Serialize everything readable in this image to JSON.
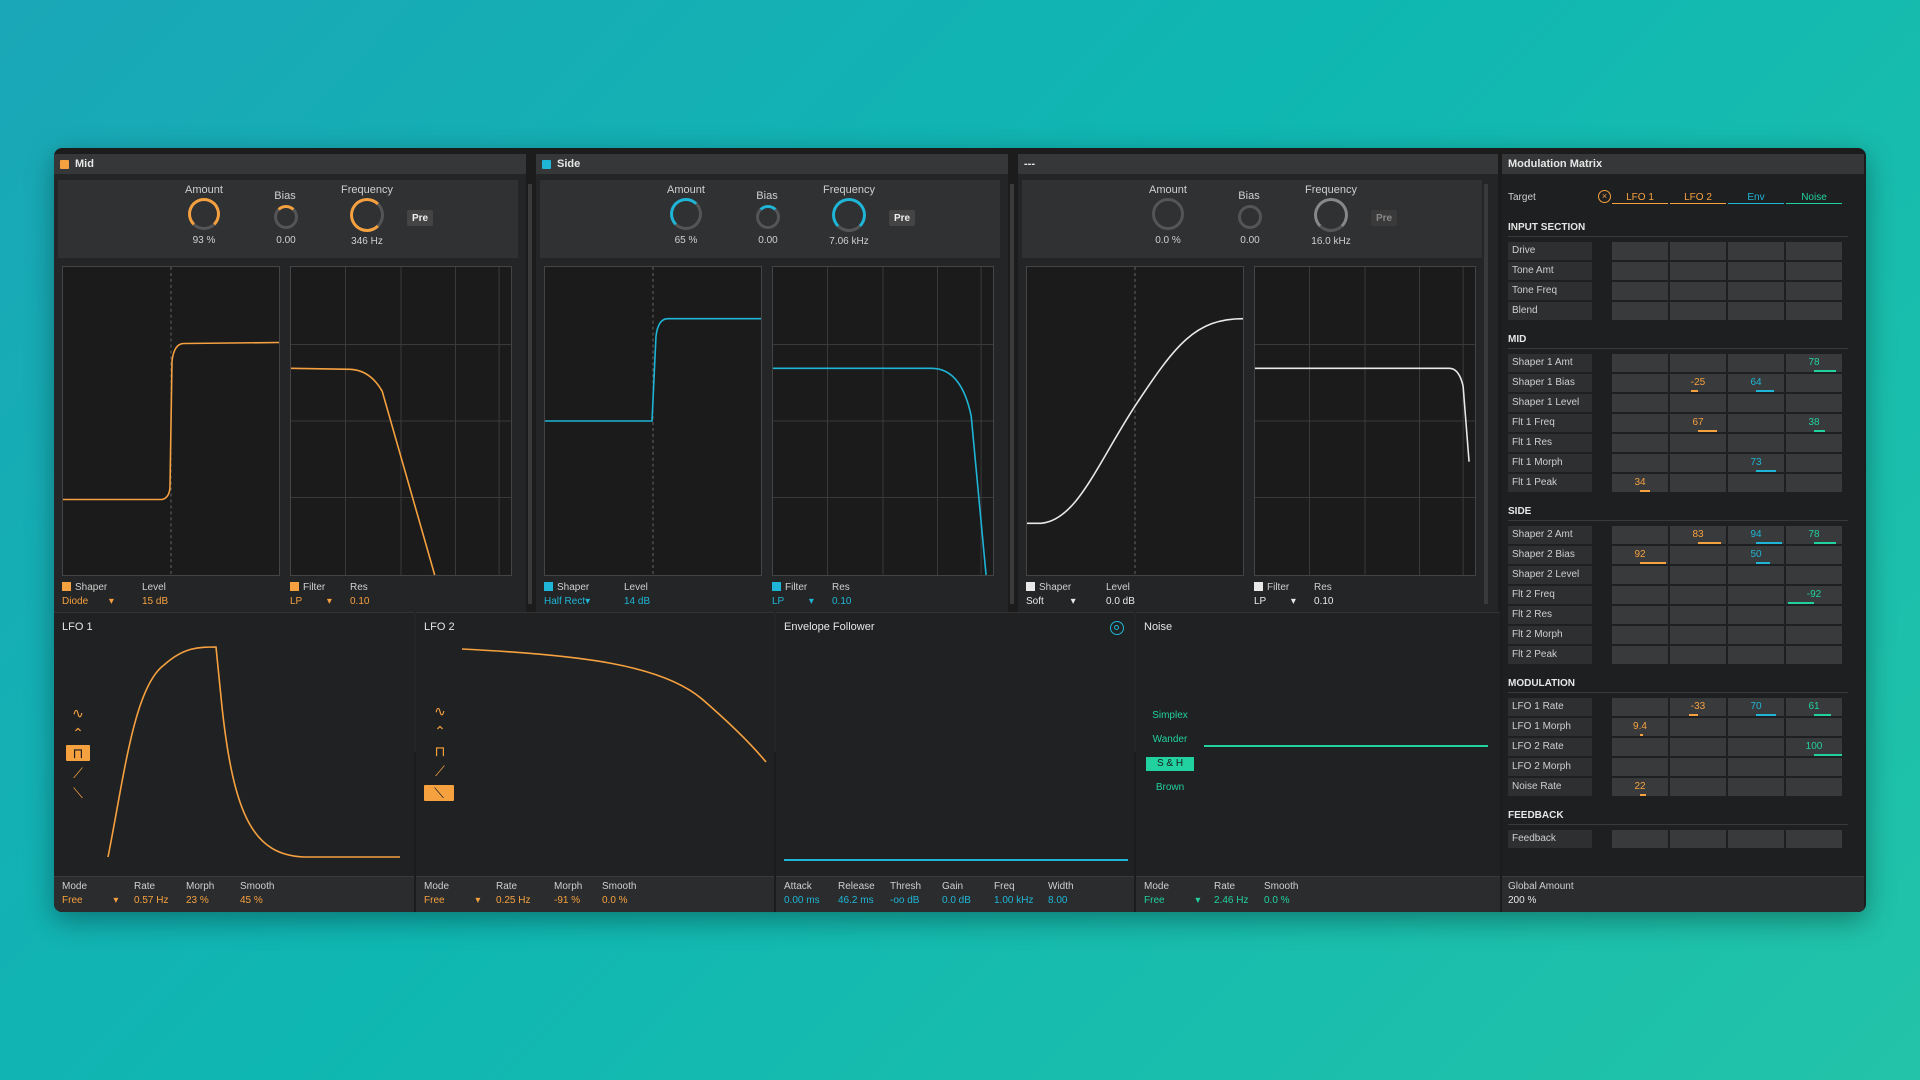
{
  "sections": [
    {
      "title": "Mid",
      "led": "#f6a140",
      "accent": "#f6a140",
      "amount_label": "Amount",
      "amount_value": "93 %",
      "bias_label": "Bias",
      "bias_value": "0.00",
      "freq_label": "Frequency",
      "freq_value": "346 Hz",
      "pre_label": "Pre",
      "shaper_label": "Shaper",
      "shaper_type": "Diode",
      "level_label": "Level",
      "level_value": "15 dB",
      "filter_label": "Filter",
      "filter_type": "LP",
      "res_label": "Res",
      "res_value": "0.10"
    },
    {
      "title": "Side",
      "led": "#1fb5d6",
      "accent": "#1fb5d6",
      "amount_label": "Amount",
      "amount_value": "65 %",
      "bias_label": "Bias",
      "bias_value": "0.00",
      "freq_label": "Frequency",
      "freq_value": "7.06 kHz",
      "pre_label": "Pre",
      "shaper_label": "Shaper",
      "shaper_type": "Half Rect",
      "level_label": "Level",
      "level_value": "14 dB",
      "filter_label": "Filter",
      "filter_type": "LP",
      "res_label": "Res",
      "res_value": "0.10"
    },
    {
      "title": "---",
      "led": "",
      "accent": "#e8e8e8",
      "amount_label": "Amount",
      "amount_value": "0.0 %",
      "bias_label": "Bias",
      "bias_value": "0.00",
      "freq_label": "Frequency",
      "freq_value": "16.0 kHz",
      "pre_label": "Pre",
      "shaper_label": "Shaper",
      "shaper_type": "Soft",
      "level_label": "Level",
      "level_value": "0.0 dB",
      "filter_label": "Filter",
      "filter_type": "LP",
      "res_label": "Res",
      "res_value": "0.10"
    }
  ],
  "lfo1": {
    "title": "LFO 1",
    "mode_label": "Mode",
    "mode_value": "Free",
    "rate_label": "Rate",
    "rate_value": "0.57 Hz",
    "morph_label": "Morph",
    "morph_value": "23 %",
    "smooth_label": "Smooth",
    "smooth_value": "45 %"
  },
  "lfo2": {
    "title": "LFO 2",
    "mode_label": "Mode",
    "mode_value": "Free",
    "rate_label": "Rate",
    "rate_value": "0.25 Hz",
    "morph_label": "Morph",
    "morph_value": "-91 %",
    "smooth_label": "Smooth",
    "smooth_value": "0.0 %"
  },
  "env": {
    "title": "Envelope Follower",
    "attack_label": "Attack",
    "attack_value": "0.00 ms",
    "release_label": "Release",
    "release_value": "46.2 ms",
    "thresh_label": "Thresh",
    "thresh_value": "-oo dB",
    "gain_label": "Gain",
    "gain_value": "0.0 dB",
    "freq_label": "Freq",
    "freq_value": "1.00 kHz",
    "width_label": "Width",
    "width_value": "8.00"
  },
  "noise": {
    "title": "Noise",
    "types": [
      "Simplex",
      "Wander",
      "S & H",
      "Brown"
    ],
    "selected": "S & H",
    "mode_label": "Mode",
    "mode_value": "Free",
    "rate_label": "Rate",
    "rate_value": "2.46 Hz",
    "smooth_label": "Smooth",
    "smooth_value": "0.0 %"
  },
  "matrix": {
    "title": "Modulation Matrix",
    "target_label": "Target",
    "columns": [
      {
        "label": "LFO 1",
        "color": "#f6a140"
      },
      {
        "label": "LFO 2",
        "color": "#f6a140"
      },
      {
        "label": "Env",
        "color": "#1fb5d6"
      },
      {
        "label": "Noise",
        "color": "#21d19f"
      }
    ],
    "groups": [
      {
        "name": "INPUT SECTION",
        "rows": [
          {
            "label": "Drive",
            "values": [
              "",
              "",
              "",
              ""
            ]
          },
          {
            "label": "Tone Amt",
            "values": [
              "",
              "",
              "",
              ""
            ]
          },
          {
            "label": "Tone Freq",
            "values": [
              "",
              "",
              "",
              ""
            ]
          },
          {
            "label": "Blend",
            "values": [
              "",
              "",
              "",
              ""
            ]
          }
        ]
      },
      {
        "name": "MID",
        "rows": [
          {
            "label": "Shaper 1 Amt",
            "values": [
              "",
              "",
              "",
              "78"
            ]
          },
          {
            "label": "Shaper 1 Bias",
            "values": [
              "",
              "-25",
              "64",
              ""
            ]
          },
          {
            "label": "Shaper 1 Level",
            "values": [
              "",
              "",
              "",
              ""
            ]
          },
          {
            "label": "Flt 1 Freq",
            "values": [
              "",
              "67",
              "",
              "38"
            ]
          },
          {
            "label": "Flt 1 Res",
            "values": [
              "",
              "",
              "",
              ""
            ]
          },
          {
            "label": "Flt 1 Morph",
            "values": [
              "",
              "",
              "73",
              ""
            ]
          },
          {
            "label": "Flt 1 Peak",
            "values": [
              "34",
              "",
              "",
              ""
            ]
          }
        ]
      },
      {
        "name": "SIDE",
        "rows": [
          {
            "label": "Shaper 2 Amt",
            "values": [
              "",
              "83",
              "94",
              "78"
            ]
          },
          {
            "label": "Shaper 2 Bias",
            "values": [
              "92",
              "",
              "50",
              ""
            ]
          },
          {
            "label": "Shaper 2 Level",
            "values": [
              "",
              "",
              "",
              ""
            ]
          },
          {
            "label": "Flt 2 Freq",
            "values": [
              "",
              "",
              "",
              "-92"
            ]
          },
          {
            "label": "Flt 2 Res",
            "values": [
              "",
              "",
              "",
              ""
            ]
          },
          {
            "label": "Flt 2 Morph",
            "values": [
              "",
              "",
              "",
              ""
            ]
          },
          {
            "label": "Flt 2 Peak",
            "values": [
              "",
              "",
              "",
              ""
            ]
          }
        ]
      },
      {
        "name": "MODULATION",
        "rows": [
          {
            "label": "LFO 1 Rate",
            "values": [
              "",
              "-33",
              "70",
              "61"
            ]
          },
          {
            "label": "LFO 1 Morph",
            "values": [
              "9.4",
              "",
              "",
              ""
            ]
          },
          {
            "label": "LFO 2 Rate",
            "values": [
              "",
              "",
              "",
              "100"
            ]
          },
          {
            "label": "LFO 2 Morph",
            "values": [
              "",
              "",
              "",
              ""
            ]
          },
          {
            "label": "Noise Rate",
            "values": [
              "22",
              "",
              "",
              ""
            ]
          }
        ]
      },
      {
        "name": "FEEDBACK",
        "rows": [
          {
            "label": "Feedback",
            "values": [
              "",
              "",
              "",
              ""
            ]
          }
        ]
      }
    ],
    "global_label": "Global Amount",
    "global_value": "200 %"
  },
  "colors": {
    "orange": "#f6a140",
    "cyan": "#1fb5d6",
    "green": "#21d19f",
    "white": "#e8e8e8"
  },
  "icons": [
    "sine-wave-icon",
    "triangle-wave-icon",
    "square-wave-icon",
    "saw-up-icon",
    "saw-down-icon",
    "close-x-icon",
    "target-circle-icon",
    "dropdown-arrow-icon"
  ]
}
